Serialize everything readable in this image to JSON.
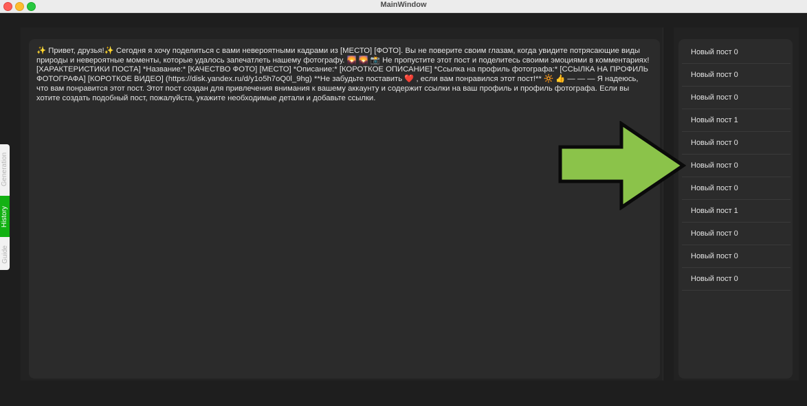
{
  "window": {
    "title": "MainWindow"
  },
  "side_tabs": [
    {
      "label": "Generation",
      "active": false
    },
    {
      "label": "History",
      "active": true
    },
    {
      "label": "Guide",
      "active": false
    }
  ],
  "editor": {
    "text": "✨ Привет, друзья!✨  Сегодня я хочу поделиться с вами невероятными кадрами из [МЕСТО] [ФОТО]. Вы не поверите своим глазам, когда увидите потрясающие виды природы и невероятные моменты, которые удалось запечатлеть нашему фотографу. 🌄 🌄 📸  Не пропустите этот пост и поделитесь своими эмоциями в комментариях! [ХАРАКТЕРИСТИКИ ПОСТА] *Название:* [КАЧЕСТВО ФОТО] [МЕСТО] *Описание:* [КОРОТКОЕ ОПИСАНИЕ] *Ссылка на профиль фотографа:* [ССЫЛКА НА ПРОФИЛЬ ФОТОГРАФА] [КОРОТКОЕ ВИДЕО] (https://disk.yandex.ru/d/y1o5h7oQ0l_9hg) **Не забудьте поставить ❤️ , если вам понравился этот пост!** 🔆 👍  — — — Я надеюсь, что вам понравится этот пост. Этот пост создан для привлечения внимания к вашему аккаунту и содержит ссылки на ваш профиль и профиль фотографа. Если вы хотите создать подобный пост, пожалуйста, укажите необходимые детали и добавьте ссылки."
  },
  "history": {
    "items": [
      {
        "label": "Новый пост 0"
      },
      {
        "label": "Новый пост 0"
      },
      {
        "label": "Новый пост 0"
      },
      {
        "label": "Новый пост 1"
      },
      {
        "label": "Новый пост 0"
      },
      {
        "label": "Новый пост 0"
      },
      {
        "label": "Новый пост 0"
      },
      {
        "label": "Новый пост 1"
      },
      {
        "label": "Новый пост 0"
      },
      {
        "label": "Новый пост 0"
      },
      {
        "label": "Новый пост 0"
      }
    ]
  },
  "colors": {
    "background": "#1e1e1e",
    "panel": "#2b2b2b",
    "active_tab": "#13b113",
    "arrow_fill": "#8bc34a",
    "arrow_stroke": "#0a0a0a"
  }
}
